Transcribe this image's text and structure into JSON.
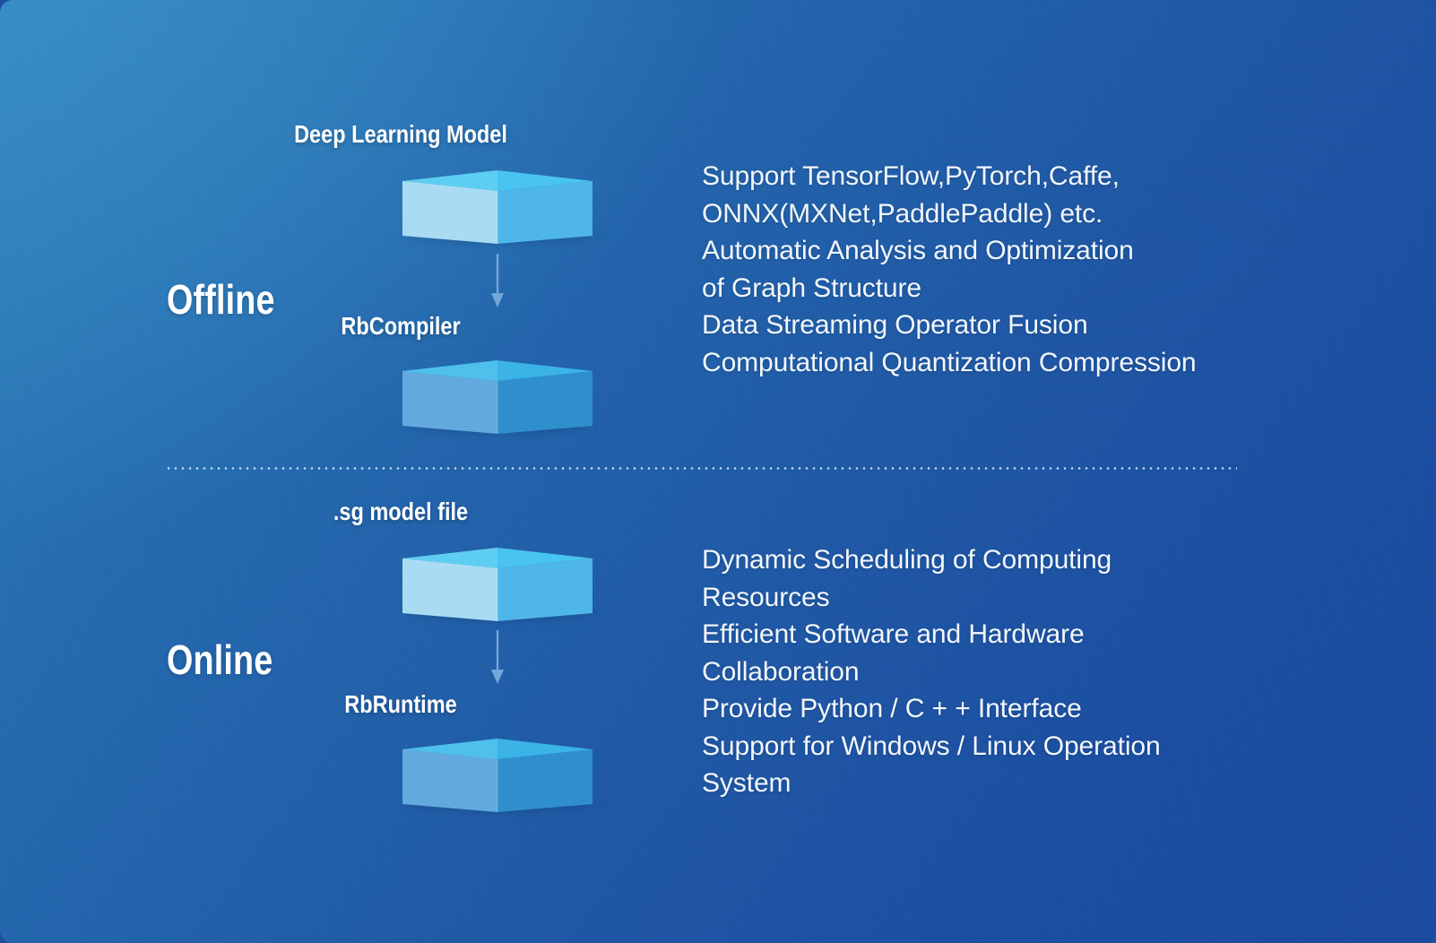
{
  "theme": {
    "background_top_left": "#2c7cb6",
    "background_bottom_right": "#1a4a9e",
    "text_color": "#f2f7fd",
    "accent_light_cyan": "#a8dcf2",
    "accent_cyan": "#4cc4ef",
    "accent_mid_blue": "#3aa0e0",
    "accent_deep_blue": "#2a7fc4"
  },
  "stages": {
    "offline": {
      "label": "Offline"
    },
    "online": {
      "label": "Online"
    }
  },
  "nodes": [
    {
      "id": "deep-learning-model",
      "title": "Deep Learning Model",
      "stage": "offline"
    },
    {
      "id": "rbcompiler",
      "title": "RbCompiler",
      "stage": "offline"
    },
    {
      "id": "sg-model-file",
      "title": ".sg model file",
      "stage": "online"
    },
    {
      "id": "rbruntime",
      "title": "RbRuntime",
      "stage": "online"
    }
  ],
  "features": {
    "offline": [
      "Support TensorFlow,PyTorch,Caffe,",
      "ONNX(MXNet,PaddlePaddle) etc.",
      "Automatic Analysis and Optimization",
      "of Graph Structure",
      "Data Streaming Operator Fusion",
      "Computational Quantization Compression"
    ],
    "online": [
      "Dynamic Scheduling of Computing",
      "Resources",
      "Efficient Software and Hardware",
      "Collaboration",
      "Provide Python / C + + Interface",
      "Support for Windows / Linux Operation",
      "System"
    ]
  }
}
